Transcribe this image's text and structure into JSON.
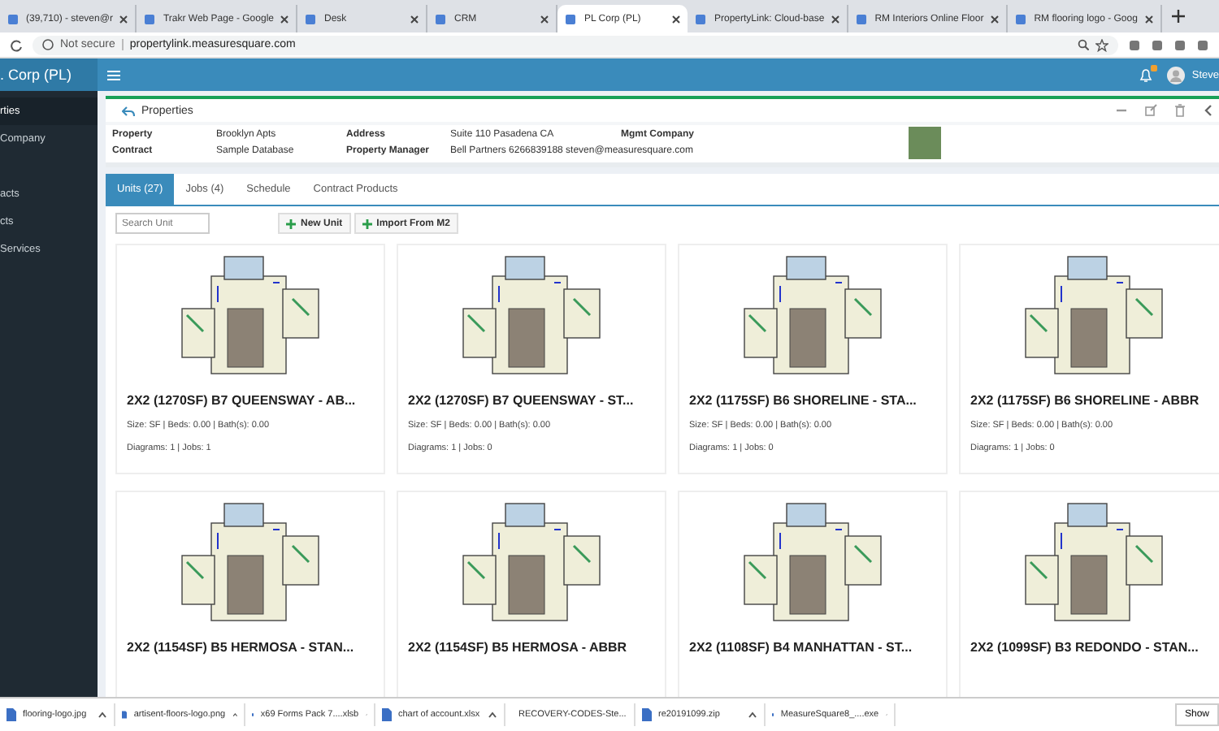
{
  "browser_tabs": [
    {
      "title": "(39,710) - steven@r",
      "selected": false
    },
    {
      "title": "Trakr Web Page - Google",
      "selected": false
    },
    {
      "title": "Desk",
      "selected": false
    },
    {
      "title": "CRM",
      "selected": false
    },
    {
      "title": "PL Corp (PL)",
      "selected": true
    },
    {
      "title": "PropertyLink: Cloud-base",
      "selected": false
    },
    {
      "title": "RM Interiors Online Floor",
      "selected": false
    },
    {
      "title": "RM flooring logo - Goog",
      "selected": false
    }
  ],
  "address_bar": {
    "security": "Not secure",
    "url": "propertylink.measuresquare.com"
  },
  "app_header": {
    "brand": ". Corp (PL)",
    "user": "Steve"
  },
  "sidebar": {
    "items": [
      {
        "label": "rties",
        "selected": true
      },
      {
        "label": "Company",
        "selected": false
      },
      {
        "label": "acts",
        "selected": false
      },
      {
        "label": "cts",
        "selected": false
      },
      {
        "label": "Services",
        "selected": false
      }
    ]
  },
  "properties": {
    "title": "Properties",
    "fields": [
      {
        "label": "Property",
        "value": "Brooklyn Apts"
      },
      {
        "label": "Address",
        "value": "Suite 110 Pasadena CA"
      },
      {
        "label": "Mgmt Company"
      },
      {
        "label": "Contract",
        "value": "Sample Database"
      },
      {
        "label": "Property Manager",
        "value": "Bell Partners 6266839188 steven@measuresquare.com"
      }
    ]
  },
  "tabs": [
    {
      "label": "Units (27)",
      "selected": true
    },
    {
      "label": "Jobs (4)",
      "selected": false
    },
    {
      "label": "Schedule",
      "selected": false
    },
    {
      "label": "Contract Products",
      "selected": false
    }
  ],
  "search": {
    "placeholder": "Search Unit"
  },
  "buttons": [
    "New Unit",
    "Import From M2"
  ],
  "units": [
    {
      "title": "2X2 (1270SF) B7 QUEENSWAY - AB...",
      "details": "Size: SF | Beds: 0.00 | Bath(s): 0.00",
      "counts": "Diagrams: 1 | Jobs: 1"
    },
    {
      "title": "2X2 (1270SF) B7 QUEENSWAY - ST...",
      "details": "Size: SF | Beds: 0.00 | Bath(s): 0.00",
      "counts": "Diagrams: 1 | Jobs: 0"
    },
    {
      "title": "2X2 (1175SF) B6 SHORELINE - STA...",
      "details": "Size: SF | Beds: 0.00 | Bath(s): 0.00",
      "counts": "Diagrams: 1 | Jobs: 0"
    },
    {
      "title": "2X2 (1175SF) B6 SHORELINE - ABBR",
      "details": "Size: SF | Beds: 0.00 | Bath(s): 0.00",
      "counts": "Diagrams: 1 | Jobs: 0"
    },
    {
      "title": "2X2 (1154SF) B5 HERMOSA - STAN..."
    },
    {
      "title": "2X2 (1154SF) B5 HERMOSA - ABBR"
    },
    {
      "title": "2X2 (1108SF) B4 MANHATTAN - ST..."
    },
    {
      "title": "2X2 (1099SF) B3 REDONDO - STAN..."
    }
  ],
  "downloads": [
    "flooring-logo.jpg",
    "artisent-floors-logo.png",
    "x69 Forms Pack 7....xlsb",
    "chart of account.xlsx",
    "RECOVERY-CODES-Ste...",
    "re20191099.zip",
    "MeasureSquare8_....exe"
  ],
  "show_all": "Show"
}
